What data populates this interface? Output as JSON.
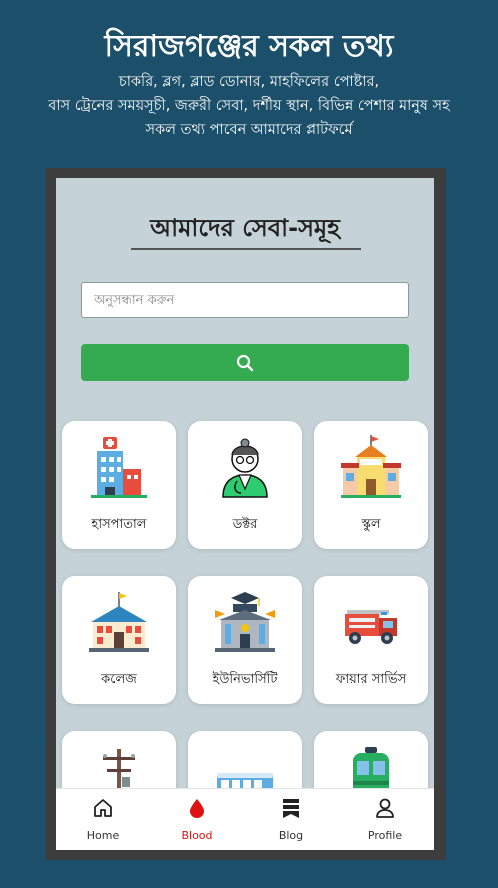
{
  "promo": {
    "title": "সিরাজগঞ্জের সকল তথ্য",
    "lines": [
      "চাকরি, ব্লগ, ব্লাড ডোনার, মাহফিলের পোষ্টার,",
      "বাস ট্রেনের সময়সূচী, জরুরী সেবা, দর্শীয় স্থান, বিভিন্ন পেশার মানুষ সহ",
      "সকল তথ্য পাবেন আমাদের প্লাটফর্মে"
    ]
  },
  "app": {
    "page_title": "আমাদের সেবা-সমূহ",
    "search": {
      "placeholder": "অনুসন্ধান করুন",
      "value": "",
      "button_icon": "search-icon",
      "button_color": "#35ab51"
    },
    "services": [
      {
        "label": "হাসপাতাল",
        "icon": "hospital-icon"
      },
      {
        "label": "ডক্টর",
        "icon": "doctor-icon"
      },
      {
        "label": "স্কুল",
        "icon": "school-icon"
      },
      {
        "label": "কলেজ",
        "icon": "college-icon"
      },
      {
        "label": "ইউনিভার্সিটি",
        "icon": "university-icon"
      },
      {
        "label": "ফায়ার সার্ভিস",
        "icon": "fire-truck-icon"
      },
      {
        "label": "",
        "icon": "electric-pole-icon"
      },
      {
        "label": "",
        "icon": "bus-icon"
      },
      {
        "label": "",
        "icon": "train-icon"
      }
    ],
    "nav": [
      {
        "label": "Home",
        "icon": "home-icon",
        "active": false
      },
      {
        "label": "Blood",
        "icon": "blood-drop-icon",
        "active": true
      },
      {
        "label": "Blog",
        "icon": "blog-icon",
        "active": false
      },
      {
        "label": "Profile",
        "icon": "profile-icon",
        "active": false
      }
    ]
  },
  "colors": {
    "background": "#1c4f69",
    "screen": "#c5d2d7",
    "accent_green": "#35ab51",
    "active_red": "#d11111"
  }
}
